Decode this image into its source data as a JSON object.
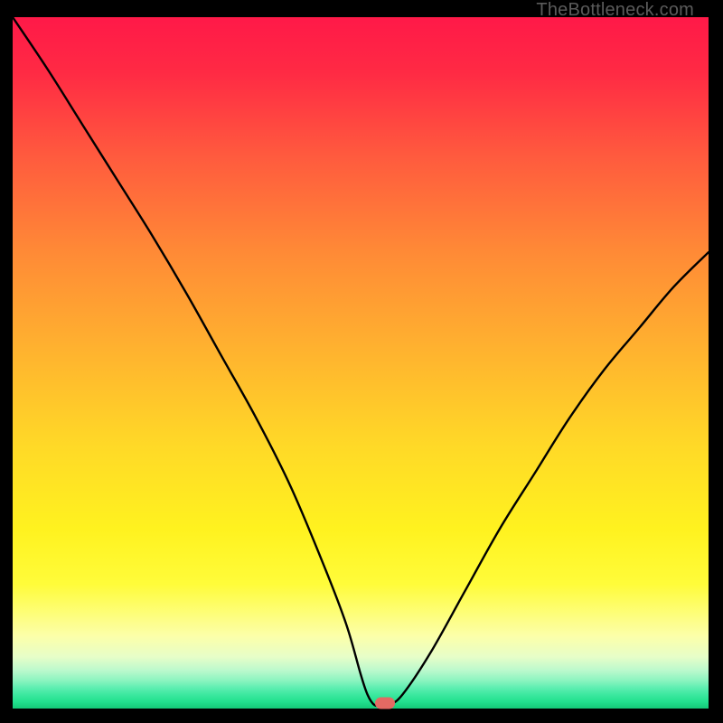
{
  "watermark": "TheBottleneck.com",
  "marker": {
    "x_pct": 53.5,
    "y_pct": 99.2,
    "color": "#e46a63"
  },
  "chart_data": {
    "type": "line",
    "title": "",
    "xlabel": "",
    "ylabel": "",
    "xlim": [
      0,
      100
    ],
    "ylim": [
      0,
      100
    ],
    "grid": false,
    "legend": false,
    "series": [
      {
        "name": "bottleneck-curve",
        "x": [
          0,
          5,
          10,
          15,
          20,
          25,
          30,
          35,
          40,
          45,
          48,
          50,
          51,
          52,
          53,
          54,
          56,
          60,
          65,
          70,
          75,
          80,
          85,
          90,
          95,
          100
        ],
        "y": [
          100,
          92.5,
          84.5,
          76.5,
          68.5,
          60,
          51,
          42,
          32,
          20,
          12,
          5,
          2,
          0.5,
          0.5,
          0.5,
          2,
          8,
          17,
          26,
          34,
          42,
          49,
          55,
          61,
          66
        ]
      }
    ],
    "annotations": [
      {
        "type": "marker",
        "x": 53.5,
        "y": 0.8,
        "color": "#e46a63"
      }
    ],
    "background_gradient": {
      "direction": "vertical",
      "stops": [
        {
          "pos": 0.0,
          "color": "#ff1948"
        },
        {
          "pos": 0.5,
          "color": "#ffb22f"
        },
        {
          "pos": 0.8,
          "color": "#fffc3a"
        },
        {
          "pos": 0.93,
          "color": "#e7fec8"
        },
        {
          "pos": 1.0,
          "color": "#14c977"
        }
      ]
    }
  }
}
